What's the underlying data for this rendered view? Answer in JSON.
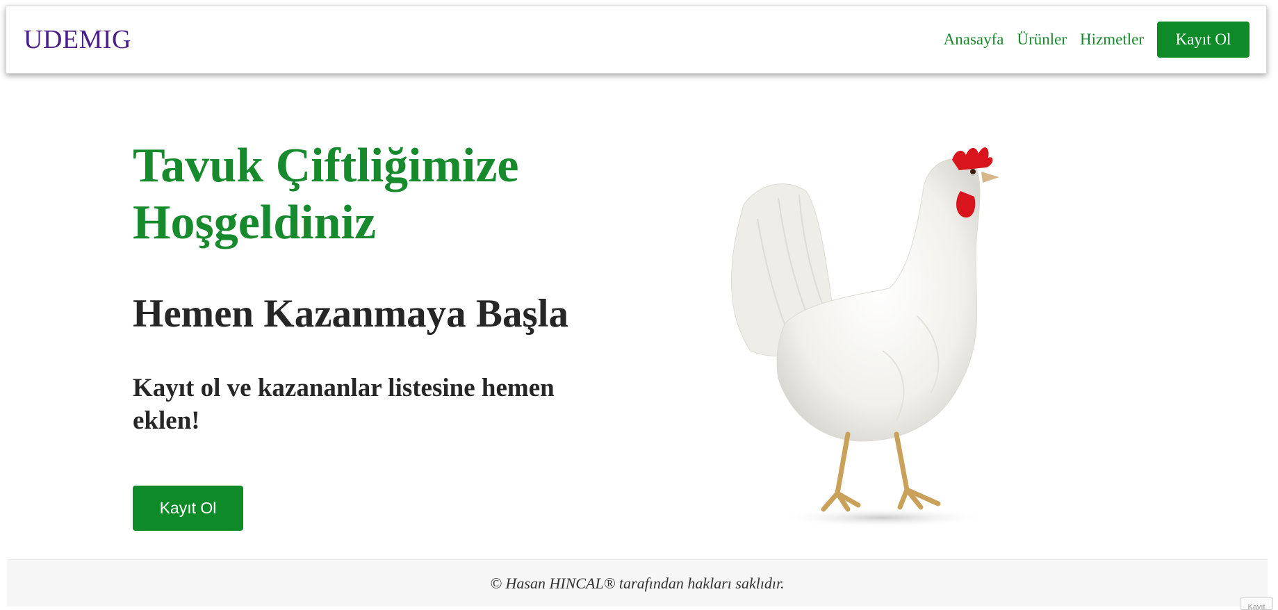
{
  "navbar": {
    "brand": "UDEMIG",
    "links": [
      "Anasayfa",
      "Ürünler",
      "Hizmetler"
    ],
    "cta_label": "Kayıt Ol"
  },
  "hero": {
    "title": "Tavuk Çiftliğimize Hoşgeldiniz",
    "subtitle": "Hemen Kazanmaya Başla",
    "description": "Kayıt ol ve kazananlar listesine hemen eklen!",
    "cta_label": "Kayıt Ol",
    "image_icon": "white-hen-image"
  },
  "footer": {
    "text": "© Hasan HINCAL® tarafından hakları saklıdır."
  },
  "corner_chip": {
    "label": "Kayıt"
  },
  "colors": {
    "brand": "#4a1f8a",
    "accent_green": "#168a2c",
    "button_green": "#0e8a28",
    "text_dark": "#262626",
    "footer_bg": "#f6f6f6"
  }
}
